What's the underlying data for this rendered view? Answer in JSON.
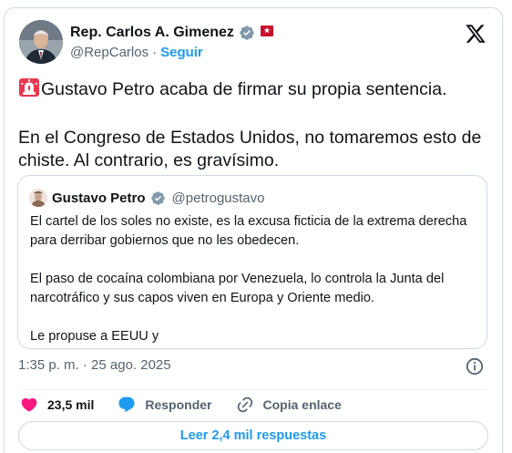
{
  "author": {
    "name": "Rep. Carlos A. Gimenez",
    "handle": "@RepCarlos",
    "separator": "·",
    "follow_label": "Seguir"
  },
  "tweet": {
    "line1": "Gustavo Petro acaba de firmar su propia sentencia.",
    "line2": "En el Congreso de Estados Unidos, no tomaremos esto de chiste. Al contrario, es gravísimo."
  },
  "quoted": {
    "name": "Gustavo Petro",
    "handle": "@petrogustavo",
    "para1": "El cartel de los soles no existe, es la excusa ficticia de la extrema derecha para derribar gobiernos que no les obedecen.",
    "para2": "El paso de cocaína colombiana por Venezuela, lo controla la Junta del narcotráfico y sus capos viven en Europa y Oriente medio.",
    "para3": "Le propuse a EEUU y"
  },
  "meta": {
    "timestamp": "1:35 p. m. · 25 ago. 2025"
  },
  "actions": {
    "likes": "23,5 mil",
    "reply_label": "Responder",
    "copy_link_label": "Copia enlace"
  },
  "read_replies_label": "Leer 2,4 mil respuestas",
  "colors": {
    "accent": "#1d9bf0",
    "like": "#f91880",
    "secondary_text": "#536471",
    "border": "#cfd9de",
    "flag_red": "#c8102e"
  },
  "icons": [
    "verified-badge-icon",
    "flag-icon",
    "x-logo-icon",
    "siren-icon",
    "info-icon",
    "heart-icon",
    "reply-bubble-icon",
    "link-icon"
  ]
}
